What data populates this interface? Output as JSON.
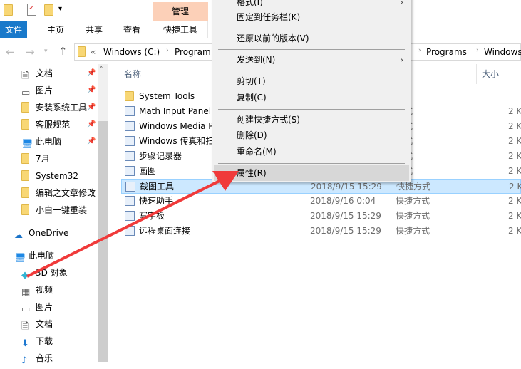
{
  "ribbon": {
    "context_tab": "管理",
    "tabs": [
      "文件",
      "主页",
      "共享",
      "查看",
      "快捷工具"
    ]
  },
  "address": {
    "parts": [
      "Windows (C:)",
      "Program",
      "Programs",
      "Windows"
    ],
    "prefix": "«"
  },
  "nav": {
    "quick": [
      {
        "label": "文档",
        "icon": "document-icon",
        "pinned": true
      },
      {
        "label": "图片",
        "icon": "picture-icon",
        "pinned": true
      },
      {
        "label": "安装系统工具",
        "icon": "folder-icon",
        "pinned": true
      },
      {
        "label": "客服规范",
        "icon": "folder-icon",
        "pinned": true
      },
      {
        "label": "此电脑",
        "icon": "computer-icon",
        "pinned": true
      },
      {
        "label": "7月",
        "icon": "folder-icon"
      },
      {
        "label": "System32",
        "icon": "folder-icon"
      },
      {
        "label": "编辑之文章修改",
        "icon": "folder-icon"
      },
      {
        "label": "小白一键重装",
        "icon": "folder-icon"
      }
    ],
    "onedrive": "OneDrive",
    "thispc": "此电脑",
    "pc_items": [
      {
        "label": "3D 对象",
        "icon": "cube-icon"
      },
      {
        "label": "视频",
        "icon": "video-icon"
      },
      {
        "label": "图片",
        "icon": "picture-icon"
      },
      {
        "label": "文档",
        "icon": "document-icon"
      },
      {
        "label": "下载",
        "icon": "download-icon"
      },
      {
        "label": "音乐",
        "icon": "music-icon"
      }
    ]
  },
  "columns": {
    "name": "名称",
    "size": "大小"
  },
  "files": [
    {
      "name": "System Tools",
      "date": "",
      "type": "夹",
      "size": ""
    },
    {
      "name": "Math Input Panel",
      "date": "",
      "type": "方式",
      "size": "2 K"
    },
    {
      "name": "Windows Media P",
      "date": "",
      "type": "方式",
      "size": "2 K"
    },
    {
      "name": "Windows 传真和扫",
      "date": "",
      "type": "方式",
      "size": "2 K"
    },
    {
      "name": "步骤记录器",
      "date": "",
      "type": "方式",
      "size": "2 K"
    },
    {
      "name": "画图",
      "date": "",
      "type": "方式",
      "size": "2 K"
    },
    {
      "name": "截图工具",
      "date": "2018/9/15 15:29",
      "type": "快捷方式",
      "size": "2 K",
      "selected": true
    },
    {
      "name": "快速助手",
      "date": "2018/9/16 0:04",
      "type": "快捷方式",
      "size": "2 K"
    },
    {
      "name": "写字板",
      "date": "2018/9/15 15:29",
      "type": "快捷方式",
      "size": "2 K"
    },
    {
      "name": "远程桌面连接",
      "date": "2018/9/15 15:29",
      "type": "快捷方式",
      "size": "2 K"
    }
  ],
  "context_menu": {
    "items": [
      "格式(I)",
      "固定到任务栏(K)",
      "还原以前的版本(V)",
      "发送到(N)",
      "剪切(T)",
      "复制(C)",
      "创建快捷方式(S)",
      "删除(D)",
      "重命名(M)",
      "属性(R)"
    ],
    "highlighted": "属性(R)"
  },
  "colors": {
    "file_tab": "#1979ca",
    "manage_tab": "#fcd0b8",
    "selection": "#cce8ff",
    "arrow": "#f03a3a"
  }
}
